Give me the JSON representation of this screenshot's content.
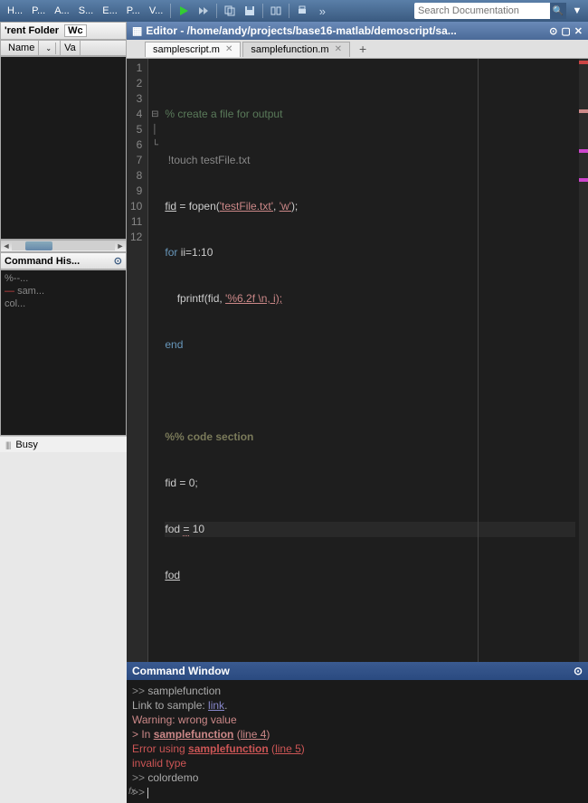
{
  "top_tabs": [
    "H...",
    "P...",
    "A...",
    "S...",
    "E...",
    "P...",
    "V..."
  ],
  "search": {
    "placeholder": "Search Documentation"
  },
  "folder_panel": {
    "title": "'rent Folder",
    "tab": "Wc",
    "cols": {
      "name": "Name",
      "sort": "⌄",
      "value": "Va"
    }
  },
  "history_panel": {
    "title": "Command His...",
    "items": [
      "%--...",
      "sam...",
      "col..."
    ]
  },
  "editor": {
    "title": "Editor - /home/andy/projects/base16-matlab/demoscript/sa...",
    "tabs": [
      {
        "name": "samplescript.m",
        "active": true
      },
      {
        "name": "samplefunction.m",
        "active": false
      }
    ],
    "line_numbers": [
      "1",
      "2",
      "3",
      "4",
      "5",
      "6",
      "7",
      "8",
      "9",
      "10",
      "11",
      "12"
    ],
    "code": {
      "l1_comment": "% create a file for output",
      "l2_bang": "!",
      "l2_cmd": "touch testFile.txt",
      "l3_var": "fid",
      "l3_rest": " = fopen(",
      "l3_str": "'testFile.txt'",
      "l3_mid": ", ",
      "l3_str2": "'w'",
      "l3_end": ");",
      "l4_for": "for",
      "l4_rest": " ii=1:10",
      "l5_fn": "    fprintf(fid, ",
      "l5_str": "'%6.2f \\n, i);",
      "l6_end": "end",
      "l8_sect": "%% code section",
      "l9": "fid = 0;",
      "l10a": "fod ",
      "l10eq": "=",
      "l10b": " 10",
      "l11": "fod"
    }
  },
  "cmd": {
    "title": "Command Window",
    "prompt": ">> ",
    "l1": "samplefunction",
    "l2a": "Link to sample: ",
    "l2b": "link",
    "l2c": ".",
    "l3": "Warning: wrong value",
    "l4a": "> In ",
    "l4b": "samplefunction",
    "l4c": " (",
    "l4d": "line 4",
    "l4e": ")",
    "l5a": "Error using ",
    "l5b": "samplefunction",
    "l5c": " (",
    "l5d": "line 5",
    "l5e": ")",
    "l6": "invalid type",
    "l7": "colordemo",
    "fx": "fx"
  },
  "status": {
    "text": "Busy"
  }
}
